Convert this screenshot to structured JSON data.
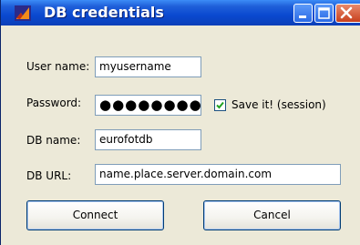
{
  "window": {
    "title": "DB credentials"
  },
  "fields": {
    "username_label": "User name:",
    "username_value": "myusername",
    "password_label": "Password:",
    "password_value": "●●●●●●●●",
    "dbname_label": "DB name:",
    "dbname_value": "eurofotdb",
    "dburl_label": "DB URL:",
    "dburl_value": "name.place.server.domain.com"
  },
  "save_checkbox": {
    "label": "Save it! (session)",
    "checked": true
  },
  "buttons": {
    "connect": "Connect",
    "cancel": "Cancel"
  },
  "icons": {
    "app": "app-icon",
    "minimize": "minimize-icon",
    "maximize": "maximize-icon",
    "close": "close-icon",
    "check": "checkmark-icon"
  },
  "colors": {
    "titlebar": "#0a49d0",
    "close_button": "#c8401e",
    "checkmark": "#21a121"
  }
}
